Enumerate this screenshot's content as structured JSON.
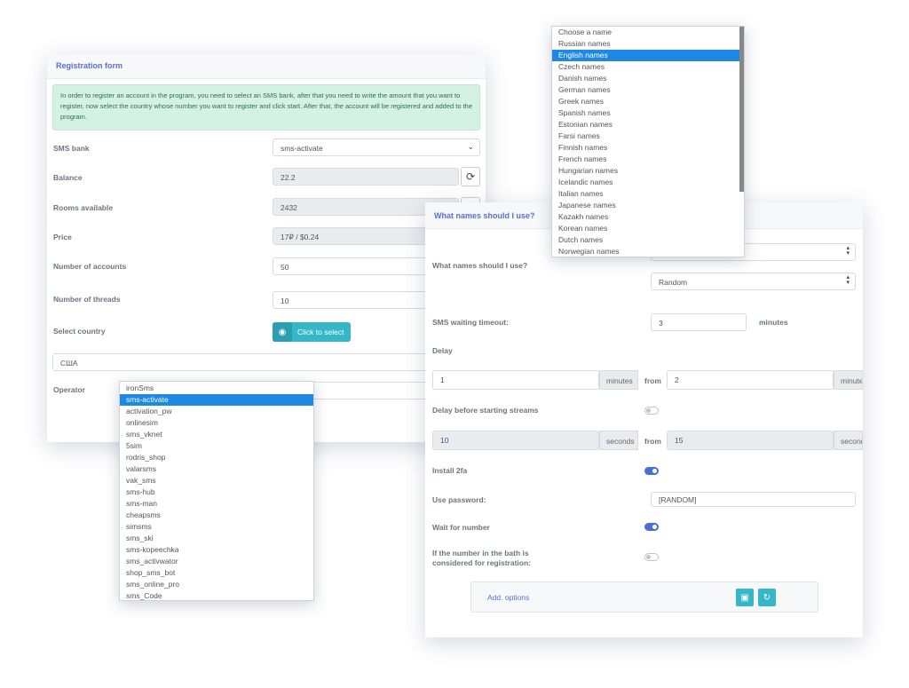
{
  "reg_form": {
    "title": "Registration form",
    "alert": "In order to register an account in the program, you need to select an SMS bank, after that you need to write the amount that you want to register, now select the country whose number you want to register and click start. After that, the account will be registered and added to the program.",
    "sms_bank_label": "SMS bank",
    "sms_bank_value": "sms-activate",
    "balance_label": "Balance",
    "balance_value": "22.2",
    "rooms_label": "Rooms available",
    "rooms_value": "2432",
    "price_label": "Price",
    "price_value": "17₽ / $0.24",
    "accounts_label": "Number of accounts",
    "accounts_value": "50",
    "threads_label": "Number of threads",
    "threads_value": "10",
    "country_label": "Select country",
    "country_button": "Click to select",
    "country_value": "США",
    "operator_label": "Operator"
  },
  "operator_list": {
    "items": [
      "ironSms",
      "sms-activate",
      "activation_pw",
      "onlinesim",
      "sms_vknet",
      "5sim",
      "rodris_shop",
      "valarsms",
      "vak_sms",
      "sms-hub",
      "sms-man",
      "cheapsms",
      "simsms",
      "sms_ski",
      "sms-kopeechka",
      "sms_activwator",
      "shop_sms_bot",
      "sms_online_pro",
      "sms_Code"
    ],
    "selected_index": 1
  },
  "names_list": {
    "items": [
      "Choose a name",
      "Russian names",
      "English names",
      "Czech names",
      "Danish names",
      "German names",
      "Greek names",
      "Spanish names",
      "Estonian names",
      "Farsi names",
      "Finnish names",
      "French names",
      "Hungarian names",
      "Icelandic names",
      "Italian names",
      "Japanese names",
      "Kazakh names",
      "Korean names",
      "Dutch names",
      "Norwegian names"
    ],
    "selected_index": 2
  },
  "settings": {
    "title": "What names should I use?",
    "names_label": "What names should I use?",
    "names_second_value": "Random",
    "sms_timeout_label": "SMS waiting timeout:",
    "sms_timeout_value": "3",
    "sms_timeout_unit": "minutes",
    "delay_label": "Delay",
    "delay_from_value": "1",
    "delay_from_unit": "minutes",
    "delay_from_word": "from",
    "delay_to_value": "2",
    "delay_to_unit": "minutes",
    "stream_delay_label": "Delay before starting streams",
    "stream_delay_enabled": false,
    "stream_from_value": "10",
    "stream_from_unit": "seconds",
    "stream_from_word": "from",
    "stream_to_value": "15",
    "stream_to_unit": "seconds",
    "install_2fa_label": "Install 2fa",
    "install_2fa_enabled": true,
    "password_label": "Use password:",
    "password_value": "[RANDOM]",
    "wait_number_label": "Wait for number",
    "wait_number_enabled": true,
    "bath_label_line1": "If the number in the bath is",
    "bath_label_line2": "considered for registration:",
    "bath_enabled": false,
    "add_options_label": "Add. options"
  },
  "colors": {
    "accent": "#5a6fcf",
    "teal": "#34b7c9",
    "selection": "#1e88e5",
    "alert_bg": "#d4f2e4"
  }
}
